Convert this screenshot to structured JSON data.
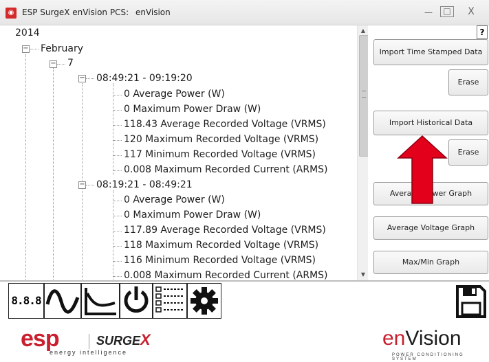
{
  "window": {
    "app_name": "ESP SurgeX enVision PCS:",
    "title": "enVision",
    "min_glyph": "—",
    "max_glyph": "□",
    "close_glyph": "X"
  },
  "tree": {
    "year": "2014",
    "month": "February",
    "day": "7",
    "sessions": [
      {
        "label": "08:49:21 - 09:19:20",
        "items": [
          "0 Average Power (W)",
          "0 Maximum Power Draw (W)",
          "118.43 Average Recorded Voltage (VRMS)",
          "120 Maximum Recorded Voltage (VRMS)",
          "117 Minimum Recorded Voltage (VRMS)",
          "0.008 Maximum Recorded Current (ARMS)"
        ]
      },
      {
        "label": "08:19:21 - 08:49:21",
        "items": [
          "0 Average Power (W)",
          "0 Maximum Power Draw (W)",
          "117.89 Average Recorded Voltage (VRMS)",
          "118 Maximum Recorded Voltage (VRMS)",
          "116 Minimum Recorded Voltage (VRMS)",
          "0.008 Maximum Recorded Current (ARMS)"
        ]
      }
    ]
  },
  "right_panel": {
    "help_label": "?",
    "import_timestamped": "Import Time Stamped Data",
    "erase_1": "Erase",
    "import_historical": "Import Historical Data",
    "erase_2": "Erase",
    "average_power_graph": "Average Power Graph",
    "average_voltage_graph": "Average Voltage Graph",
    "maxmin_graph": "Max/Min Graph"
  },
  "toolbar": {
    "digital_display_label": "8.8.8",
    "icons": [
      "digital-display-icon",
      "sine-wave-icon",
      "decay-curve-icon",
      "power-icon",
      "data-list-icon",
      "gear-icon",
      "save-icon"
    ]
  },
  "footer": {
    "esp_logo": "esp",
    "esp_tagline": "energy intelligence",
    "surgex_logo": "SURGE",
    "surgex_x": "X",
    "envision_en": "en",
    "envision_rest": "Vision",
    "envision_tagline": "POWER CONDITIONING SYSTEM"
  },
  "colors": {
    "brand_red": "#c8202f",
    "arrow_red": "#e3001b"
  }
}
